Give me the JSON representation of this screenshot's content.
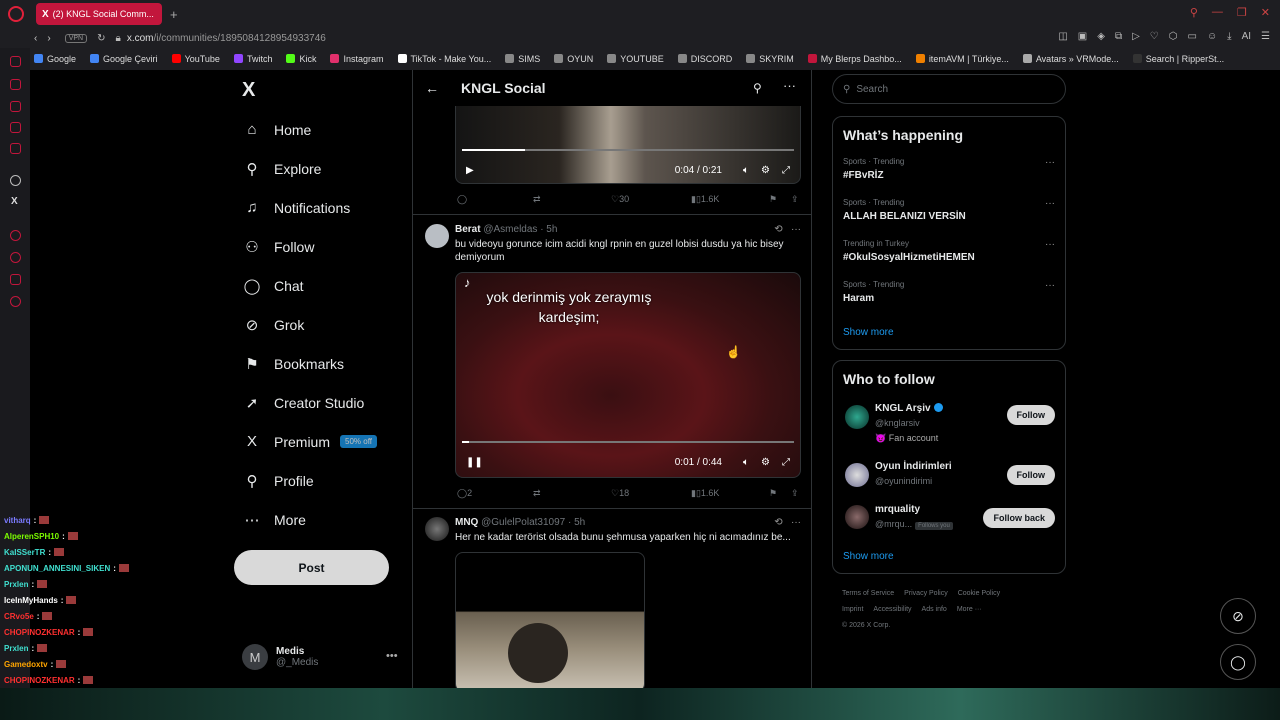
{
  "browser": {
    "tab_title": "(2) KNGL Social Comm...",
    "url_prefix": "x.com",
    "url_path": "/i/communities/1895084128954933746",
    "vpn": "VPN",
    "bookmarks": [
      {
        "label": "Google",
        "color": "#4285f4"
      },
      {
        "label": "Google Çeviri",
        "color": "#4285f4"
      },
      {
        "label": "YouTube",
        "color": "#ff0000"
      },
      {
        "label": "Twitch",
        "color": "#9146ff"
      },
      {
        "label": "Kick",
        "color": "#53fc18"
      },
      {
        "label": "Instagram",
        "color": "#e1306c"
      },
      {
        "label": "TikTok - Make You...",
        "color": "#ffffff"
      },
      {
        "label": "SIMS",
        "color": "#888888"
      },
      {
        "label": "OYUN",
        "color": "#888888"
      },
      {
        "label": "YOUTUBE",
        "color": "#888888"
      },
      {
        "label": "DISCORD",
        "color": "#888888"
      },
      {
        "label": "SKYRIM",
        "color": "#888888"
      },
      {
        "label": "My Blerps Dashbo...",
        "color": "#c2163c"
      },
      {
        "label": "itemAVM | Türkiye...",
        "color": "#f08000"
      },
      {
        "label": "Avatars » VRMode...",
        "color": "#aaaaaa"
      },
      {
        "label": "Search | RipperSt...",
        "color": "#333333"
      }
    ]
  },
  "nav": {
    "logo": "X",
    "items": [
      {
        "label": "Home",
        "icon": "home-icon",
        "glyph": "⌂"
      },
      {
        "label": "Explore",
        "icon": "search-icon",
        "glyph": "⚲"
      },
      {
        "label": "Notifications",
        "icon": "bell-icon",
        "glyph": "♫"
      },
      {
        "label": "Follow",
        "icon": "person-plus-icon",
        "glyph": "⚇"
      },
      {
        "label": "Chat",
        "icon": "chat-icon",
        "glyph": "◯"
      },
      {
        "label": "Grok",
        "icon": "grok-icon",
        "glyph": "⊘"
      },
      {
        "label": "Bookmarks",
        "icon": "bookmark-icon",
        "glyph": "⚑"
      },
      {
        "label": "Creator Studio",
        "icon": "rocket-icon",
        "glyph": "➚"
      },
      {
        "label": "Premium",
        "icon": "x-premium-icon",
        "glyph": "X"
      },
      {
        "label": "Profile",
        "icon": "profile-icon",
        "glyph": "⚲"
      },
      {
        "label": "More",
        "icon": "more-circle-icon",
        "glyph": "⋯"
      }
    ],
    "premium_badge": "50% off",
    "post_label": "Post",
    "account": {
      "initial": "M",
      "name": "Medis",
      "handle": "@_Medis"
    }
  },
  "feed": {
    "title": "KNGL Social",
    "top_video": {
      "time": "0:04 / 0:21",
      "progress": 0.19
    },
    "top_actions": {
      "likes": "30",
      "views": "1.6K"
    },
    "tweets": [
      {
        "name": "Berat",
        "handle": "@Asmeldas",
        "time": "· 5h",
        "text": "bu videoyu gorunce icim acidi kngl rpnin en guzel lobisi dusdu ya hic bisey demiyorum",
        "video_caption_1": "yok derinmiş yok zeraymış",
        "video_caption_2": "kardeşim;",
        "video_time": "0:01 / 0:44",
        "progress": 0.02,
        "replies": "2",
        "likes": "18",
        "views": "1.6K"
      },
      {
        "name": "MNQ",
        "handle": "@GulelPolat31097",
        "time": "· 5h",
        "text": "Her ne kadar terörist olsada bunu şehmusa yaparken hiç ni acımadınız be..."
      }
    ]
  },
  "right": {
    "search_placeholder": "Search",
    "happening_title": "What’s happening",
    "trends": [
      {
        "category": "Sports · Trending",
        "name": "#FBvRİZ"
      },
      {
        "category": "Sports · Trending",
        "name": "ALLAH BELANIZI VERSİN"
      },
      {
        "category": "Trending in Turkey",
        "name": "#OkulSosyalHizmetiHEMEN"
      },
      {
        "category": "Sports · Trending",
        "name": "Haram"
      }
    ],
    "show_more": "Show more",
    "wtf_title": "Who to follow",
    "wtf": [
      {
        "name": "KNGL Arşiv",
        "handle": "@knglarsiv",
        "sub": "😈 Fan account",
        "button": "Follow"
      },
      {
        "name": "Oyun İndirimleri",
        "handle": "@oyunindirimi",
        "sub": "",
        "button": "Follow"
      },
      {
        "name": "mrquality",
        "handle": "@mrqu...",
        "follows_you": "Follows you",
        "button": "Follow back"
      }
    ],
    "wtf_show_more": "Show more",
    "footer": [
      "Terms of Service",
      "Privacy Policy",
      "Cookie Policy",
      "Imprint",
      "Accessibility",
      "Ads info",
      "More ···",
      "© 2026 X Corp."
    ]
  },
  "chat": [
    {
      "user": "vitharq",
      "msg": ":",
      "color": "#7b7bff"
    },
    {
      "user": "AlperenSPH10",
      "msg": ":",
      "color": "#7cfc00"
    },
    {
      "user": "KaISSerTR",
      "msg": ":",
      "color": "#40e0d0"
    },
    {
      "user": "APONUN_ANNESINI_SIKEN",
      "msg": ":",
      "color": "#40e0d0"
    },
    {
      "user": "Prxlen",
      "msg": ":",
      "color": "#40e0d0"
    },
    {
      "user": "IceInMyHands",
      "msg": ":",
      "color": "#ffffff"
    },
    {
      "user": "CRvo5e",
      "msg": ":",
      "color": "#ff3030"
    },
    {
      "user": "CHOPINOZKENAR",
      "msg": ":",
      "color": "#ff3030"
    },
    {
      "user": "Prxlen",
      "msg": ":",
      "color": "#40e0d0"
    },
    {
      "user": "Gamedoxtv",
      "msg": ":",
      "color": "#ffa500"
    },
    {
      "user": "CHOPINOZKENAR",
      "msg": ":",
      "color": "#ff3030"
    }
  ]
}
